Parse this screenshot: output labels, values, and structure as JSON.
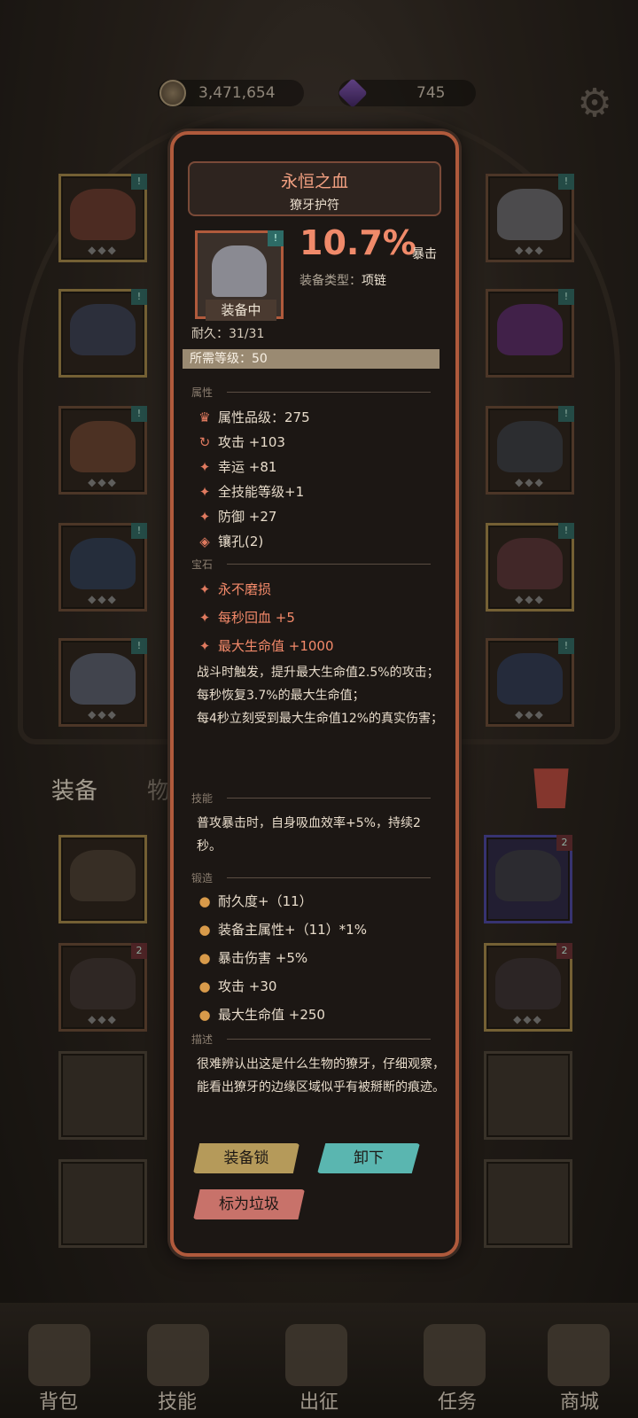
{
  "currency": {
    "gold": "3,471,654",
    "gems": "745"
  },
  "tabs": {
    "equipment": "装备",
    "items": "物"
  },
  "nav": [
    "背包",
    "技能",
    "出征",
    "任务",
    "商城"
  ],
  "item": {
    "name": "永恒之血",
    "type_name": "獠牙护符",
    "equipped_label": "装备中",
    "stat_value": "10.7%",
    "stat_label": "暴击",
    "category_label": "装备类型：",
    "category_value": "项链",
    "durability": "耐久：31/31",
    "required_level": "所需等级：50",
    "sections": {
      "attributes": "属性",
      "gems": "宝石",
      "skill": "技能",
      "forge": "锻造",
      "desc": "描述"
    },
    "attributes": [
      "属性品级：275",
      "攻击 +103",
      "幸运 +81",
      "全技能等级+1",
      "防御 +27",
      "镶孔(2)"
    ],
    "gems": [
      "永不磨损",
      "每秒回血 +5",
      "最大生命值 +1000"
    ],
    "gem_effect": [
      "战斗时触发，提升最大生命值2.5%的攻击；",
      "每秒恢复3.7%的最大生命值；",
      "每4秒立刻受到最大生命值12%的真实伤害；"
    ],
    "skill_text": "普攻暴击时，自身吸血效率+5%，持续2秒。",
    "forge": [
      "耐久度+（11）",
      "装备主属性+（11）*1%",
      "暴击伤害 +5%",
      "攻击 +30",
      "最大生命值 +250"
    ],
    "description": "很难辨认出这是什么生物的獠牙，仔细观察，能看出獠牙的边缘区域似乎有被掰断的痕迹。"
  },
  "buttons": {
    "lock": "装备锁",
    "unequip": "卸下",
    "junk": "标为垃圾"
  }
}
